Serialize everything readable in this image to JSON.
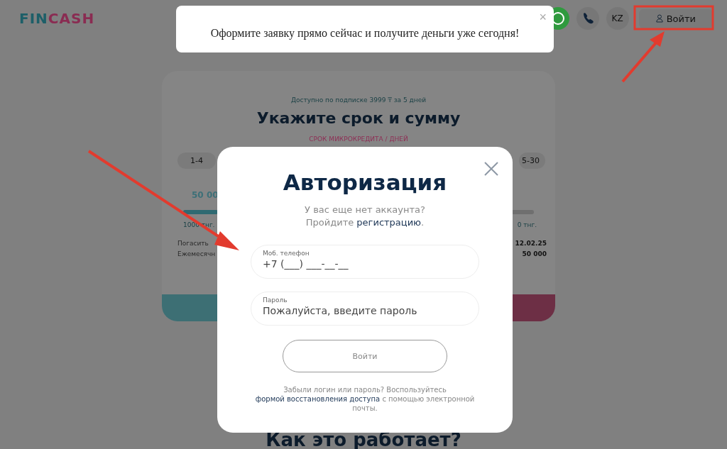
{
  "header": {
    "logo": [
      {
        "text": "FIN",
        "color": "#1d5f68"
      },
      {
        "text": "CASH",
        "color": "#8a2c52"
      }
    ],
    "language": "KZ",
    "login_button": "Войти"
  },
  "toast": {
    "message": "Оформите заявку прямо сейчас и получите деньги уже сегодня!",
    "close": "×"
  },
  "calculator": {
    "subscription_note": "Доступно по подписке 3999 ₸ за 5 дней",
    "title": "Укажите срок и сумму",
    "term_label": "СРОК МИКРОКРЕДИТА / ДНЕЙ",
    "term_options": [
      {
        "label": "1-4",
        "selected": false
      },
      {
        "label": "5-30",
        "selected": false
      }
    ],
    "amount": "50 00",
    "slider": {
      "level": 0.1
    },
    "min_label": "1000 тнг.",
    "max_label": "0 тнг.",
    "rows": [
      {
        "label": "Погасить",
        "value": "12.02.25"
      },
      {
        "label": "Ежемесячн",
        "value": "50 000"
      }
    ]
  },
  "section_heading": "Как это работает?",
  "modal": {
    "title": "Авторизация",
    "no_account": "У вас еще нет аккаунта?",
    "register_prefix": "Пройдите ",
    "register_link": "регистрацию",
    "register_suffix": ".",
    "phone": {
      "label": "Моб. телефон",
      "placeholder": "+7 (___) ___-__-__"
    },
    "password": {
      "label": "Пароль",
      "placeholder": "Пожалуйста, введите пароль"
    },
    "submit": "Войти",
    "forgot_prefix": "Забыли логин или пароль? Воспользуйтесь ",
    "forgot_link": "формой восстановления доступа",
    "forgot_suffix": " с помощью электронной почты."
  }
}
